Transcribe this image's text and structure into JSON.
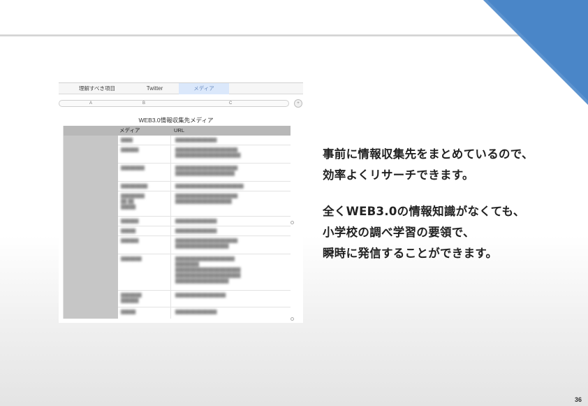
{
  "slide": {
    "page_number": "36",
    "accent_color": "#4a86c8",
    "paragraphs": [
      [
        "事前に情報収集先をまとめているので、",
        "効率よくリサーチできます。"
      ],
      [
        "全くWEB3.0の情報知識がなくても、",
        "小学校の調べ学習の要領で、",
        "瞬時に発信することができます。"
      ]
    ]
  },
  "sheet": {
    "tabs": [
      "理解すべき項目",
      "Twitter",
      "メディア"
    ],
    "active_tab": "メディア",
    "columns": [
      "A",
      "B",
      "C"
    ],
    "title": "WEB3.0情報収集先メディア",
    "headers": {
      "media": "メディア",
      "url": "URL"
    }
  }
}
